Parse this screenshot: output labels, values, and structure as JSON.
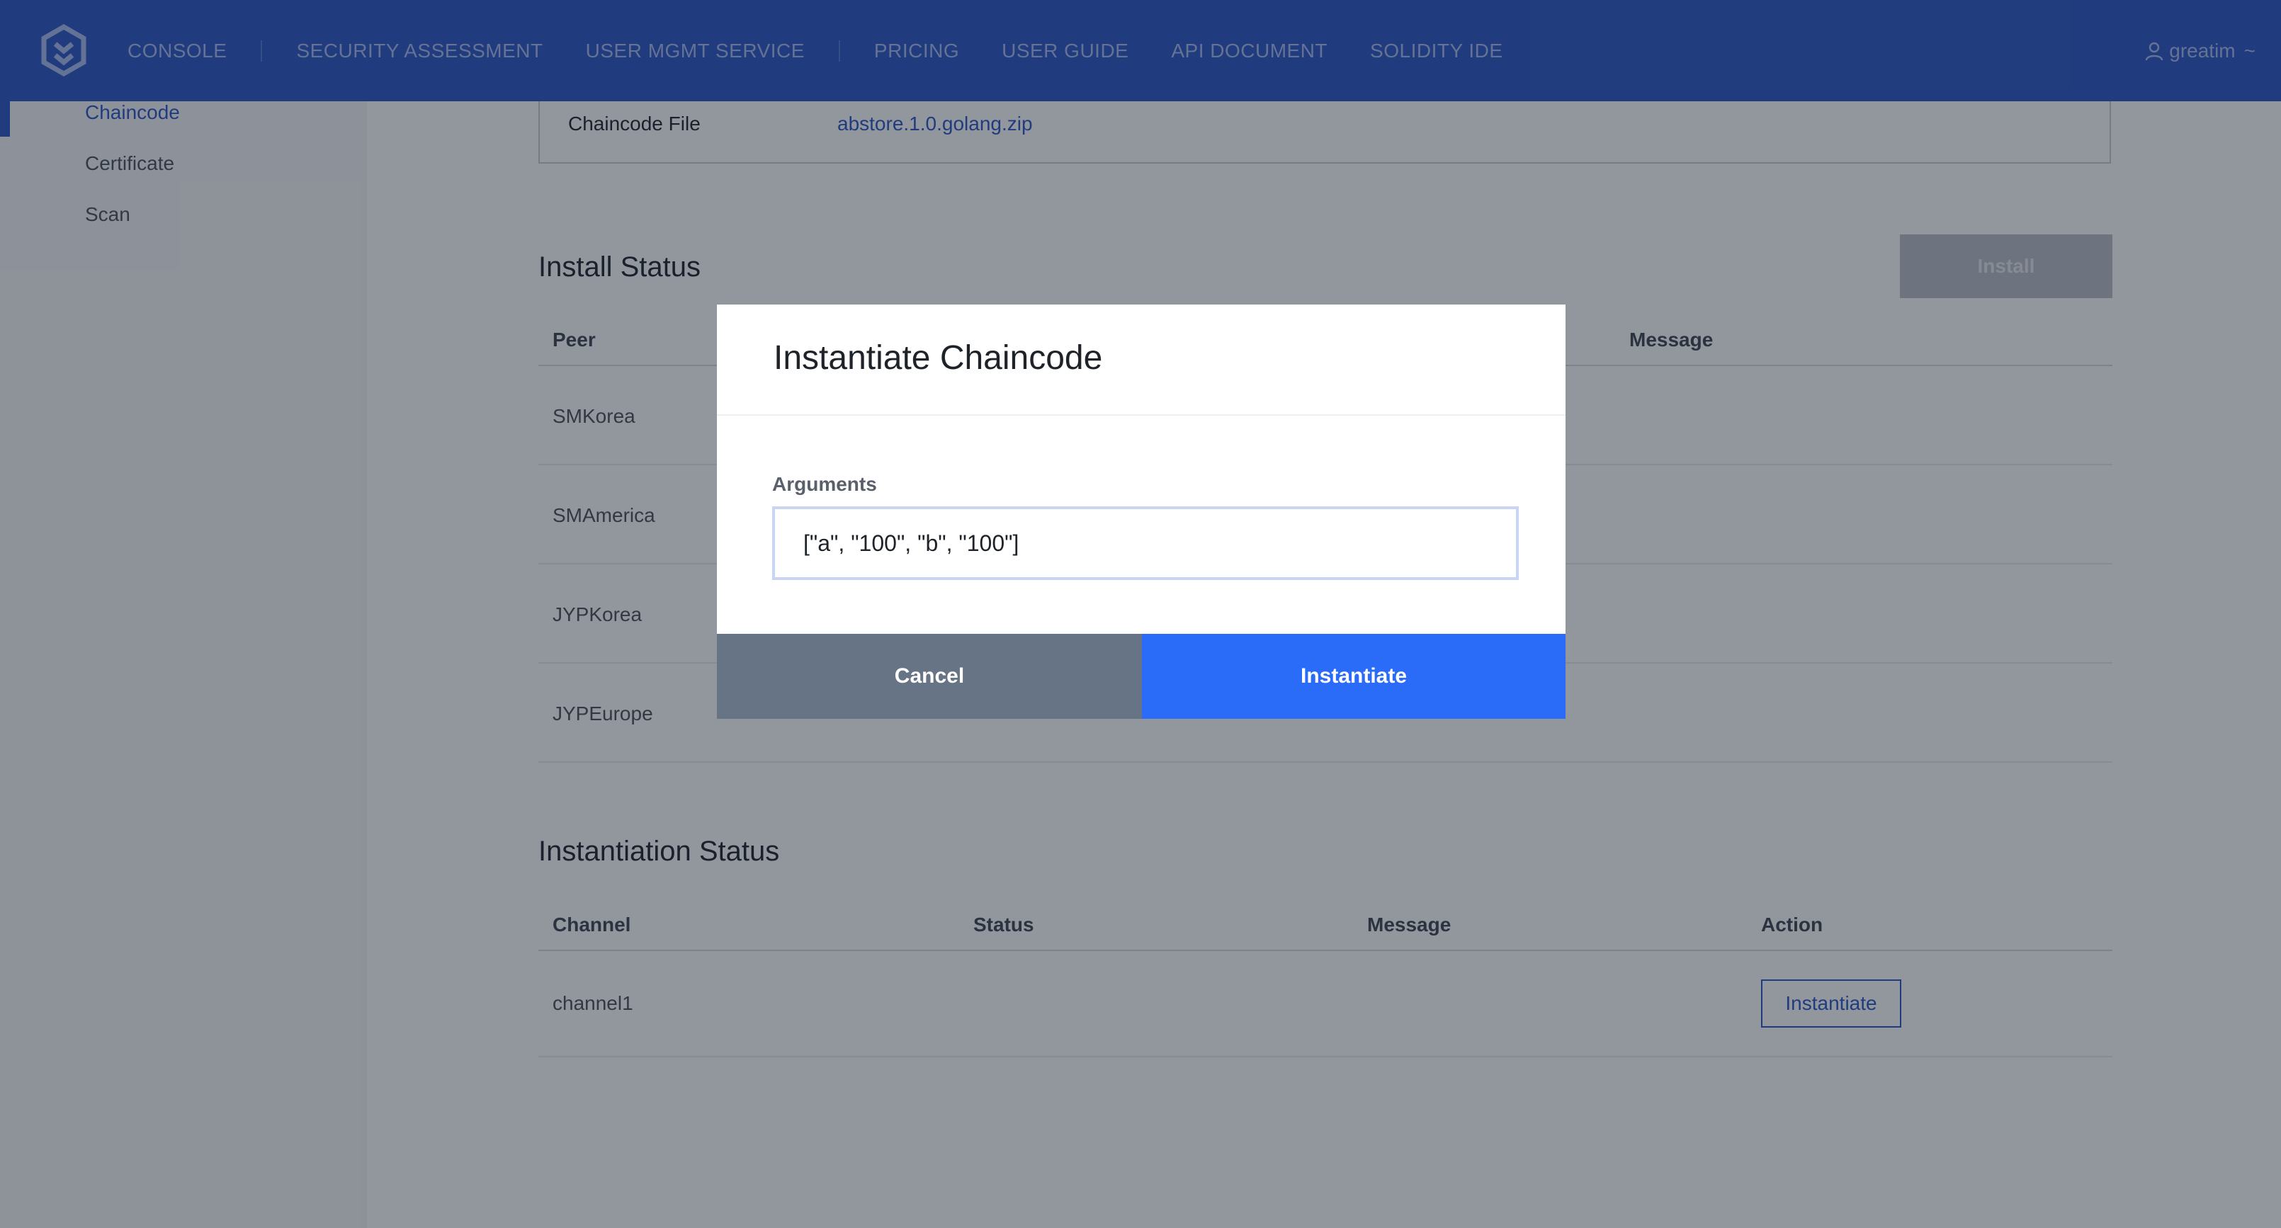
{
  "header": {
    "nav": [
      {
        "label": "CONSOLE"
      },
      {
        "label": "SECURITY ASSESSMENT"
      },
      {
        "label": "USER MGMT SERVICE"
      },
      {
        "label": "PRICING"
      },
      {
        "label": "USER GUIDE"
      },
      {
        "label": "API DOCUMENT"
      },
      {
        "label": "SOLIDITY IDE"
      }
    ],
    "user": "greatim",
    "user_menu_indicator": "~"
  },
  "sidebar": {
    "items": [
      {
        "label": "Chaincode",
        "active": true
      },
      {
        "label": "Certificate"
      },
      {
        "label": "Scan"
      }
    ]
  },
  "chaincode_file": {
    "label": "Chaincode File",
    "value": "abstore.1.0.golang.zip"
  },
  "install_status": {
    "title": "Install Status",
    "install_button": "Install",
    "columns": [
      "Peer",
      "Message"
    ],
    "rows": [
      {
        "peer": "SMKorea"
      },
      {
        "peer": "SMAmerica"
      },
      {
        "peer": "JYPKorea"
      },
      {
        "peer": "JYPEurope"
      }
    ]
  },
  "instantiation_status": {
    "title": "Instantiation Status",
    "columns": [
      "Channel",
      "Status",
      "Message",
      "Action"
    ],
    "rows": [
      {
        "channel": "channel1",
        "action": "Instantiate"
      }
    ]
  },
  "modal": {
    "title": "Instantiate Chaincode",
    "arguments_label": "Arguments",
    "arguments_value": "[\"a\", \"100\", \"b\", \"100\"]",
    "cancel_label": "Cancel",
    "confirm_label": "Instantiate"
  },
  "colors": {
    "brand": "#2a56c5",
    "primary_button": "#2a6bf8",
    "cancel_button": "#667485"
  }
}
